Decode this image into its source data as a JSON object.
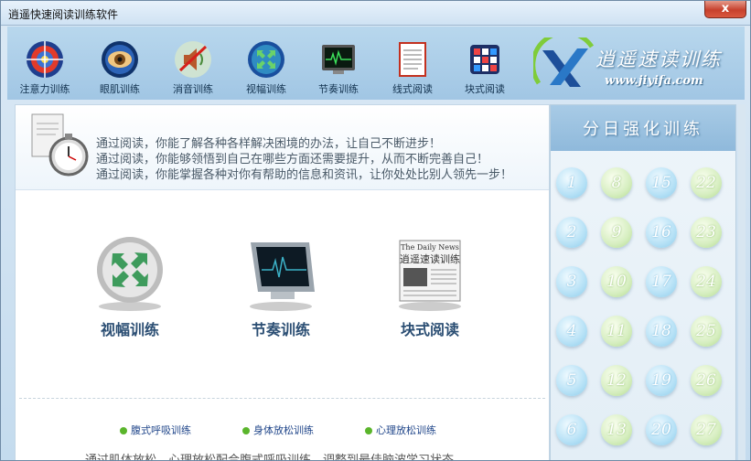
{
  "window": {
    "title": "逍遥快速阅读训练软件",
    "close_symbol": "x"
  },
  "toolbar": {
    "items": [
      {
        "label": "注意力训练",
        "icon": "target-icon"
      },
      {
        "label": "眼肌训练",
        "icon": "eye-icon"
      },
      {
        "label": "消音训练",
        "icon": "mute-icon"
      },
      {
        "label": "视幅训练",
        "icon": "expand-icon"
      },
      {
        "label": "节奏训练",
        "icon": "monitor-icon"
      },
      {
        "label": "线式阅读",
        "icon": "notepad-icon"
      },
      {
        "label": "块式阅读",
        "icon": "blocks-icon"
      }
    ],
    "brand": {
      "title": "逍遥速读训练",
      "url": "www.jiyifa.com"
    }
  },
  "banner": {
    "lines": [
      "通过阅读，你能了解各种各样解决困境的办法，让自己不断进步！",
      "通过阅读，你能够领悟到自己在哪些方面还需要提升，从而不断完善自己！",
      "通过阅读，你能掌握各种对你有帮助的信息和资讯，让你处处比别人领先一步！"
    ]
  },
  "features": [
    {
      "label": "视幅训练",
      "icon": "expand-arrows-icon"
    },
    {
      "label": "节奏训练",
      "icon": "monitor-icon"
    },
    {
      "label": "块式阅读",
      "icon": "newspaper-icon",
      "newspaper_heading": "The Daily News",
      "newspaper_title": "逍遥速读训练"
    }
  ],
  "sublinks": [
    {
      "label": "腹式呼吸训练"
    },
    {
      "label": "身体放松训练"
    },
    {
      "label": "心理放松训练"
    }
  ],
  "description": "通过肌体放松、心理放松配合腹式呼吸训练，调整到最佳脑波学习状态",
  "panel": {
    "title": "分日强化训练",
    "days": [
      "1",
      "2",
      "3",
      "4",
      "5",
      "6",
      "8",
      "9",
      "10",
      "11",
      "12",
      "13",
      "15",
      "16",
      "17",
      "18",
      "19",
      "20",
      "22",
      "23",
      "24",
      "25",
      "26",
      "27"
    ]
  },
  "colors": {
    "accent": "#2b4e73",
    "panel_head": "#8fb9db",
    "close": "#c7402d"
  }
}
